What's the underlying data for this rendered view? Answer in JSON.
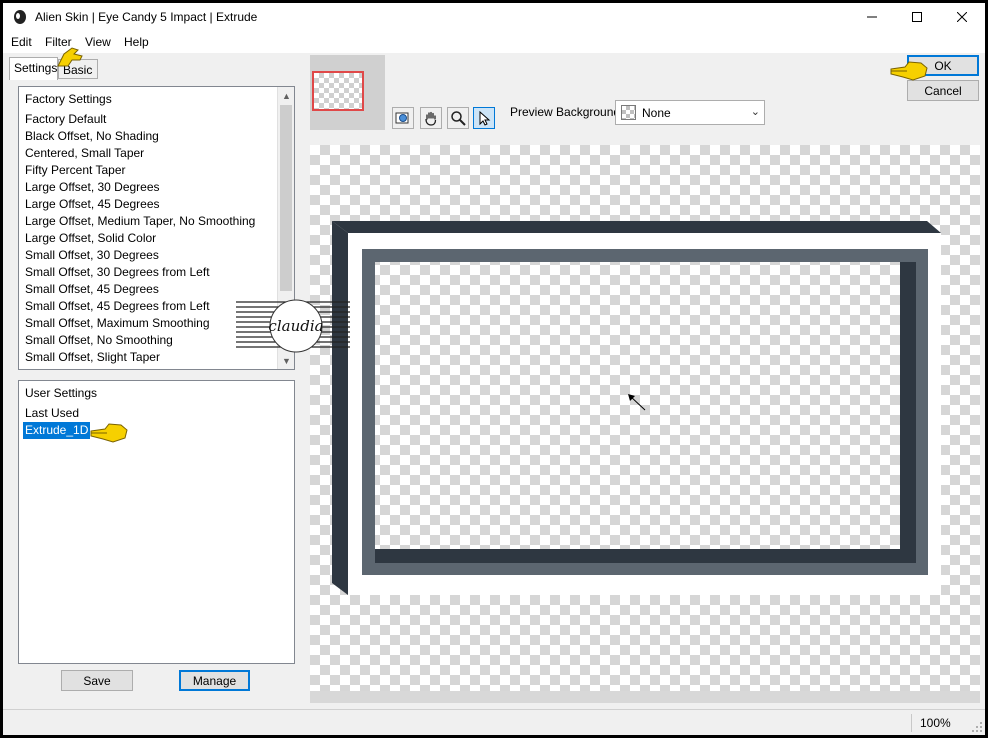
{
  "window": {
    "title": "Alien Skin | Eye Candy 5 Impact | Extrude",
    "icon": "alien-skin-logo-icon",
    "controls": [
      "minimize-icon",
      "maximize-icon",
      "close-icon"
    ]
  },
  "menu": {
    "edit": "Edit",
    "filter": "Filter",
    "view": "View",
    "help": "Help"
  },
  "tabs": {
    "settings": "Settings",
    "basic": "Basic"
  },
  "factory": {
    "header": "Factory Settings",
    "items": [
      "Factory Default",
      "Black Offset, No Shading",
      "Centered, Small Taper",
      "Fifty Percent Taper",
      "Large Offset, 30 Degrees",
      "Large Offset, 45 Degrees",
      "Large Offset, Medium Taper, No Smoothing",
      "Large Offset, Solid Color",
      "Small Offset, 30 Degrees",
      "Small Offset, 30 Degrees from Left",
      "Small Offset, 45 Degrees",
      "Small Offset, 45 Degrees from Left",
      "Small Offset, Maximum Smoothing",
      "Small Offset, No Smoothing",
      "Small Offset, Slight Taper"
    ]
  },
  "user": {
    "header": "User Settings",
    "items": [
      "Last Used",
      "Extrude_1D"
    ],
    "selected": "Extrude_1D"
  },
  "buttons": {
    "save": "Save",
    "manage": "Manage",
    "ok": "OK",
    "cancel": "Cancel"
  },
  "toolbar": {
    "tools": [
      "navigator-icon",
      "hand-tool-icon",
      "zoom-tool-icon",
      "select-arrow-icon"
    ],
    "preview_background_label": "Preview Background:",
    "preview_background_value": "None"
  },
  "watermark": "claudia",
  "status": {
    "zoom": "100%"
  },
  "colors": {
    "selection": "#0078d7",
    "frame_outer": "#2e3741",
    "frame_inner": "#5c6670",
    "pointer_hand": "#f6d000",
    "thumbnail_outline": "#e04848"
  }
}
